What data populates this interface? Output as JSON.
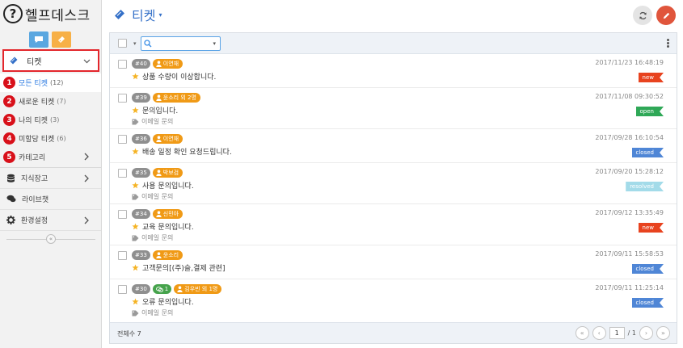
{
  "app": {
    "logo_symbol": "?",
    "logo_text": "헬프데스크"
  },
  "sidebar": {
    "mode_buttons": [
      {
        "icon": "chat-icon",
        "color": "#5aa7e0"
      },
      {
        "icon": "ticket-icon",
        "color": "#f7b047"
      }
    ],
    "ticket_section": {
      "label": "티켓",
      "highlight_color": "#e3262c"
    },
    "sub_items": [
      {
        "num": "1",
        "label": "모든 티켓",
        "count": "(12)",
        "active": true
      },
      {
        "num": "2",
        "label": "새로운 티켓",
        "count": "(7)"
      },
      {
        "num": "3",
        "label": "나의 티켓",
        "count": "(3)"
      },
      {
        "num": "4",
        "label": "미할당 티켓",
        "count": "(6)"
      },
      {
        "num": "5",
        "label": "카테고리",
        "count": "",
        "has_arrow": true
      }
    ],
    "nav_items": [
      {
        "icon": "database-icon",
        "label": "지식장고"
      },
      {
        "icon": "chat-icon",
        "label": "라이브챗"
      },
      {
        "icon": "gear-icon",
        "label": "환경설정"
      }
    ],
    "collapse_symbol": "«"
  },
  "header": {
    "title": "티켓",
    "caret": "▾",
    "accent": "#3470c8"
  },
  "toolbar": {
    "search_value": "",
    "caret": "▾"
  },
  "tickets": [
    {
      "id": "#40",
      "user": "이연재",
      "subject": "상품 수량이 이상합니다.",
      "category": "",
      "date": "2017/11/23 16:48:19",
      "status": "new",
      "status_color": "#e8431f"
    },
    {
      "id": "#39",
      "user": "윤소리 외 2명",
      "subject": "문의입니다.",
      "category": "이메일 문의",
      "date": "2017/11/08 09:30:52",
      "status": "open",
      "status_color": "#2fa857"
    },
    {
      "id": "#36",
      "user": "이연재",
      "subject": "배송 일정 확인 요청드립니다.",
      "category": "",
      "date": "2017/09/28 16:10:54",
      "status": "closed",
      "status_color": "#4f86d6"
    },
    {
      "id": "#35",
      "user": "박보검",
      "subject": "사용 문의입니다.",
      "category": "이메일 문의",
      "date": "2017/09/20 15:28:12",
      "status": "resolved",
      "status_color": "#a3dbe9"
    },
    {
      "id": "#34",
      "user": "신민아",
      "subject": "교육 문의입니다.",
      "category": "이메일 문의",
      "date": "2017/09/12 13:35:49",
      "status": "new",
      "status_color": "#e8431f"
    },
    {
      "id": "#33",
      "user": "윤소리",
      "subject": "고객문의[(주)슬,결제 관련]",
      "category": "",
      "date": "2017/09/11 15:58:53",
      "status": "closed",
      "status_color": "#4f86d6"
    },
    {
      "id": "#30",
      "chat_count": "1",
      "user": "김우빈 외 1명",
      "subject": "오류 문의입니다.",
      "category": "이메일 문의",
      "date": "2017/09/11 11:25:14",
      "status": "closed",
      "status_color": "#4f86d6"
    }
  ],
  "footer": {
    "total_label": "전체수 7",
    "page_current": "1",
    "page_total": "/ 1",
    "btn_first": "«",
    "btn_prev": "‹",
    "btn_next": "›",
    "btn_last": "»"
  }
}
